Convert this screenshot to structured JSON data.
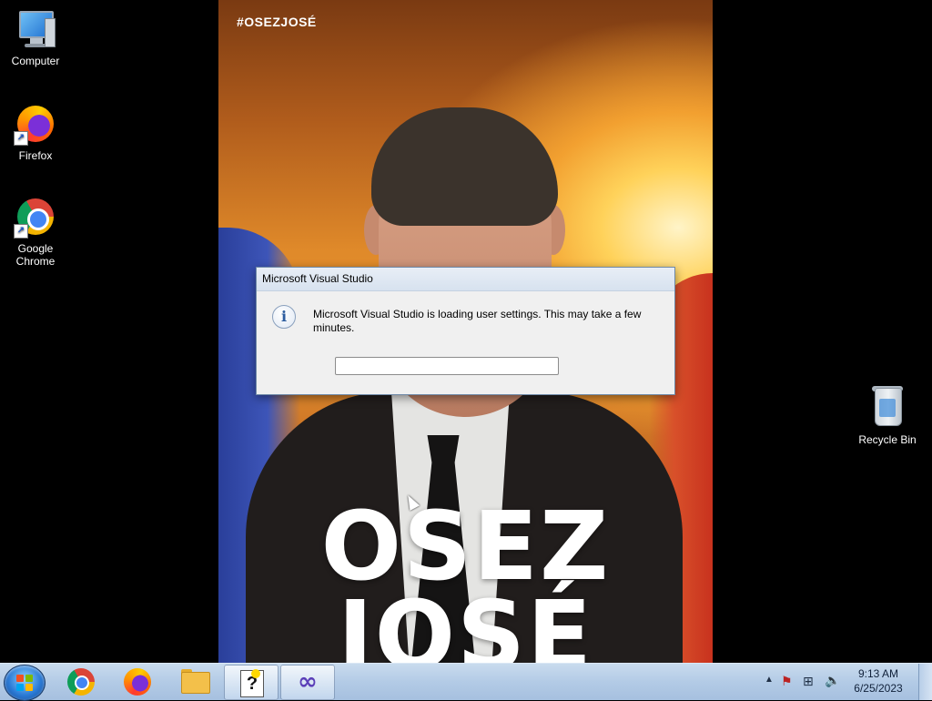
{
  "desktop": {
    "icons": [
      {
        "label": "Computer",
        "icon": "computer-icon"
      },
      {
        "label": "Firefox",
        "icon": "firefox-icon"
      },
      {
        "label": "Google Chrome",
        "icon": "chrome-icon"
      },
      {
        "label": "Recycle Bin",
        "icon": "recycle-bin-icon"
      }
    ]
  },
  "wallpaper": {
    "hashtag": "#OSEZJOSÉ",
    "slogan_line1": "OSEZ",
    "slogan_line2": "JOSÉ"
  },
  "dialog": {
    "title": "Microsoft Visual Studio",
    "message": "Microsoft Visual Studio is loading user settings. This may take a few minutes.",
    "icon": "info-icon",
    "progress": 0
  },
  "taskbar": {
    "start": "start-button",
    "pinned": [
      {
        "icon": "chrome-icon",
        "active": false
      },
      {
        "icon": "firefox-icon",
        "active": false
      },
      {
        "icon": "file-explorer-icon",
        "active": false
      },
      {
        "icon": "help-icon",
        "active": true
      },
      {
        "icon": "visual-studio-icon",
        "active": true
      }
    ],
    "tray_icons": [
      "show-hidden-icons-arrow",
      "action-center-flag-icon",
      "network-icon",
      "volume-muted-icon"
    ],
    "time": "9:13 AM",
    "date": "6/25/2023"
  }
}
